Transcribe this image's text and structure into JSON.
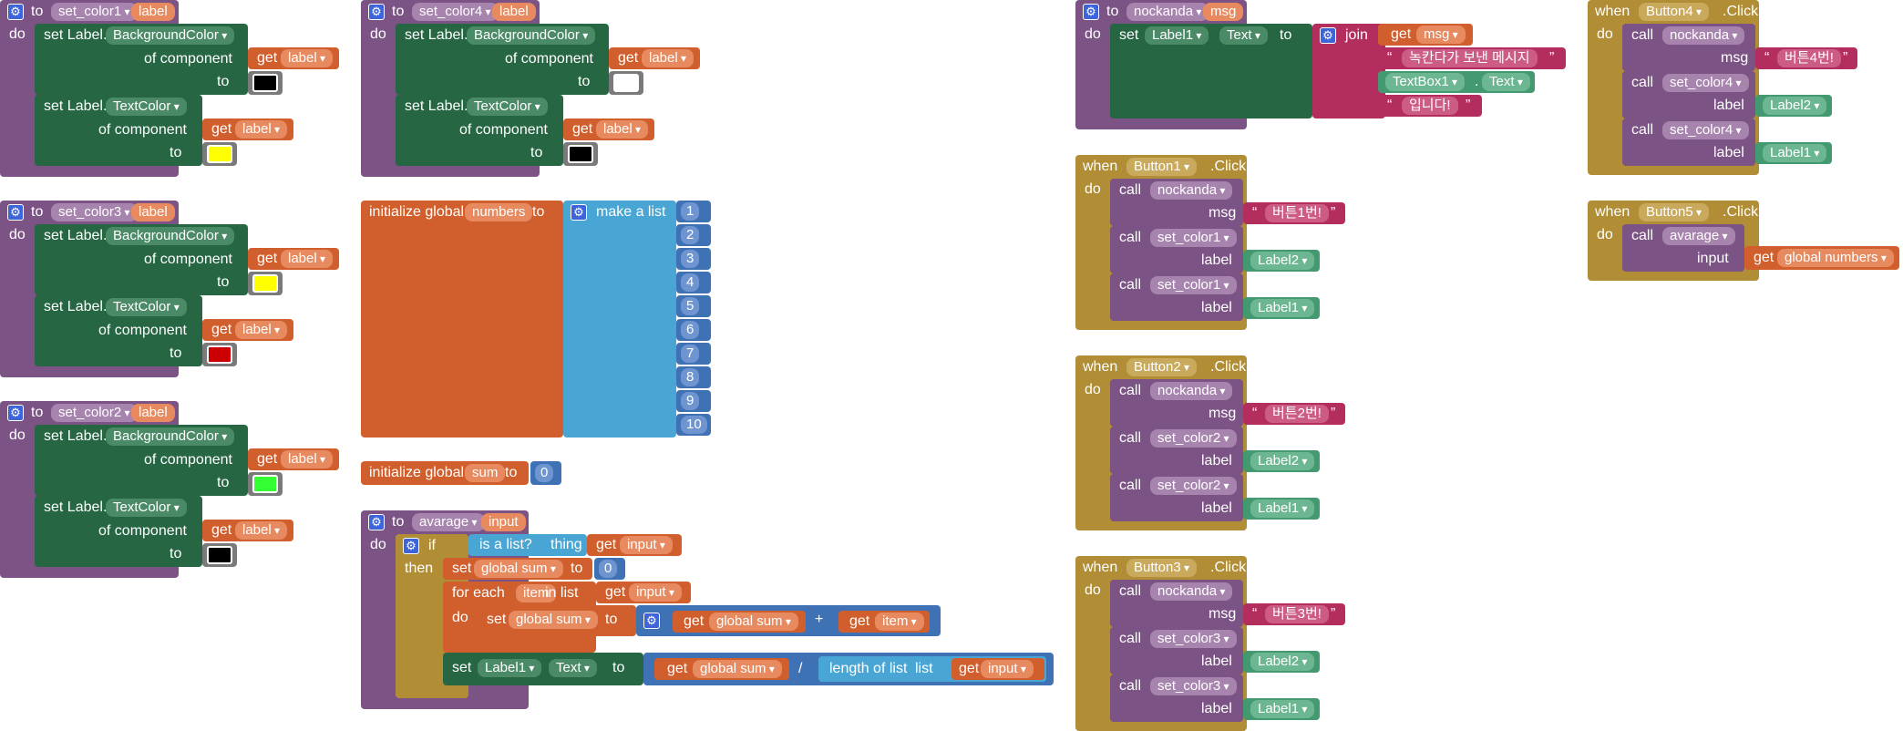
{
  "ui": {
    "to": "to",
    "do": "do",
    "then": "then",
    "if": "if",
    "when": "when",
    "call": "call",
    "set": "set",
    "get": "get",
    "join": "join",
    "set_label_prefix": "set Label.",
    "of_component": "of component",
    "init_global": "initialize global",
    "make_a_list": "make a list",
    "is_a_list": "is a list?",
    "thing": "thing",
    "for_each": "for each",
    "in_list": "in list",
    "length_of_list": "length of list",
    "list": "list",
    "msg_param": "msg",
    "label_param": "label",
    "input_param": "input",
    "click": ".Click",
    "plus": "+",
    "divide": "/"
  },
  "procedures": [
    {
      "name": "set_color1",
      "param": "label",
      "bg": "#000000",
      "text": "#ffff00"
    },
    {
      "name": "set_color3",
      "param": "label",
      "bg": "#ffff00",
      "text": "#cc0000"
    },
    {
      "name": "set_color2",
      "param": "label",
      "bg": "#33ff33",
      "text": "#000000"
    },
    {
      "name": "set_color4",
      "param": "label",
      "bg": "#ffffff",
      "text": "#000000"
    }
  ],
  "props": {
    "bg": "BackgroundColor",
    "text": "TextColor"
  },
  "globals": {
    "numbers": {
      "name": "numbers",
      "items": [
        "1",
        "2",
        "3",
        "4",
        "5",
        "6",
        "7",
        "8",
        "9",
        "10"
      ]
    },
    "sum": {
      "name": "sum",
      "value": "0"
    }
  },
  "avarage": {
    "name": "avarage",
    "param": "input",
    "global_sum": "global sum",
    "item": "item",
    "label": "Label1",
    "prop": "Text",
    "zero": "0"
  },
  "nockanda": {
    "name": "nockanda",
    "param": "msg",
    "label": "Label1",
    "prop": "Text",
    "join1": "녹칸다가 보낸 메시지",
    "textbox": "TextBox1",
    "textbox_prop": "Text",
    "join2": "입니다!"
  },
  "events": [
    {
      "button": "Button1",
      "msg": "버튼1번!",
      "c1": "set_color1",
      "l1": "Label2",
      "c2": "set_color1",
      "l2": "Label1"
    },
    {
      "button": "Button2",
      "msg": "버튼2번!",
      "c1": "set_color2",
      "l1": "Label2",
      "c2": "set_color2",
      "l2": "Label1"
    },
    {
      "button": "Button3",
      "msg": "버튼3번!",
      "c1": "set_color3",
      "l1": "Label2",
      "c2": "set_color3",
      "l2": "Label1"
    },
    {
      "button": "Button4",
      "msg": "버튼4번!",
      "c1": "set_color4",
      "l1": "Label2",
      "c2": "set_color4",
      "l2": "Label1"
    }
  ],
  "button5": {
    "button": "Button5",
    "call": "avarage",
    "arg": "input",
    "get": "global numbers"
  }
}
